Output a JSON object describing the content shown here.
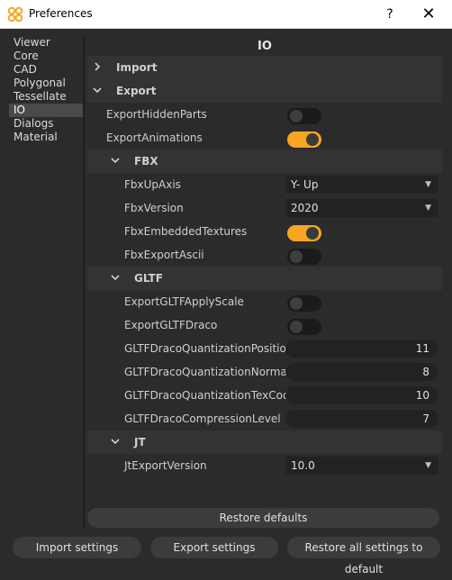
{
  "window": {
    "title": "Preferences",
    "help_glyph": "?",
    "close_glyph": "✕"
  },
  "sidebar": {
    "items": [
      {
        "label": "Viewer"
      },
      {
        "label": "Core"
      },
      {
        "label": "CAD"
      },
      {
        "label": "Polygonal"
      },
      {
        "label": "Tessellate"
      },
      {
        "label": "IO",
        "selected": true
      },
      {
        "label": "Dialogs"
      },
      {
        "label": "Material"
      }
    ]
  },
  "main": {
    "section_title": "IO",
    "groups": {
      "import": {
        "label": "Import",
        "expanded": false
      },
      "export": {
        "label": "Export",
        "expanded": true
      },
      "fbx": {
        "label": "FBX",
        "expanded": true
      },
      "gltf": {
        "label": "GLTF",
        "expanded": true
      },
      "jt": {
        "label": "JT",
        "expanded": true
      }
    },
    "export": {
      "export_hidden_parts": {
        "label": "ExportHiddenParts",
        "value": false
      },
      "export_animations": {
        "label": "ExportAnimations",
        "value": true
      }
    },
    "fbx": {
      "up_axis": {
        "label": "FbxUpAxis",
        "value": "Y- Up"
      },
      "version": {
        "label": "FbxVersion",
        "value": "2020"
      },
      "embedded_textures": {
        "label": "FbxEmbeddedTextures",
        "value": true
      },
      "export_ascii": {
        "label": "FbxExportAscii",
        "value": false
      }
    },
    "gltf": {
      "apply_scale": {
        "label": "ExportGLTFApplyScale",
        "value": false
      },
      "draco": {
        "label": "ExportGLTFDraco",
        "value": false
      },
      "quant_position": {
        "label": "GLTFDracoQuantizationPosition",
        "value": "11"
      },
      "quant_normal": {
        "label": "GLTFDracoQuantizationNormal",
        "value": "8"
      },
      "quant_texcoord": {
        "label": "GLTFDracoQuantizationTexCoord",
        "value": "10"
      },
      "compression_level": {
        "label": "GLTFDracoCompressionLevel",
        "value": "7"
      }
    },
    "jt": {
      "export_version": {
        "label": "JtExportVersion",
        "value": "10.0"
      }
    }
  },
  "buttons": {
    "restore_defaults": "Restore defaults",
    "import_settings": "Import settings",
    "export_settings": "Export settings",
    "restore_all": "Restore all settings to default"
  },
  "icons": {
    "chevron_right": "›",
    "chevron_down": "⌄",
    "dropdown_arrow": "▼"
  },
  "colors": {
    "accent_toggle_on": "#f6a623",
    "app_icon": "#f6a623",
    "background": "#2b2b2b"
  }
}
